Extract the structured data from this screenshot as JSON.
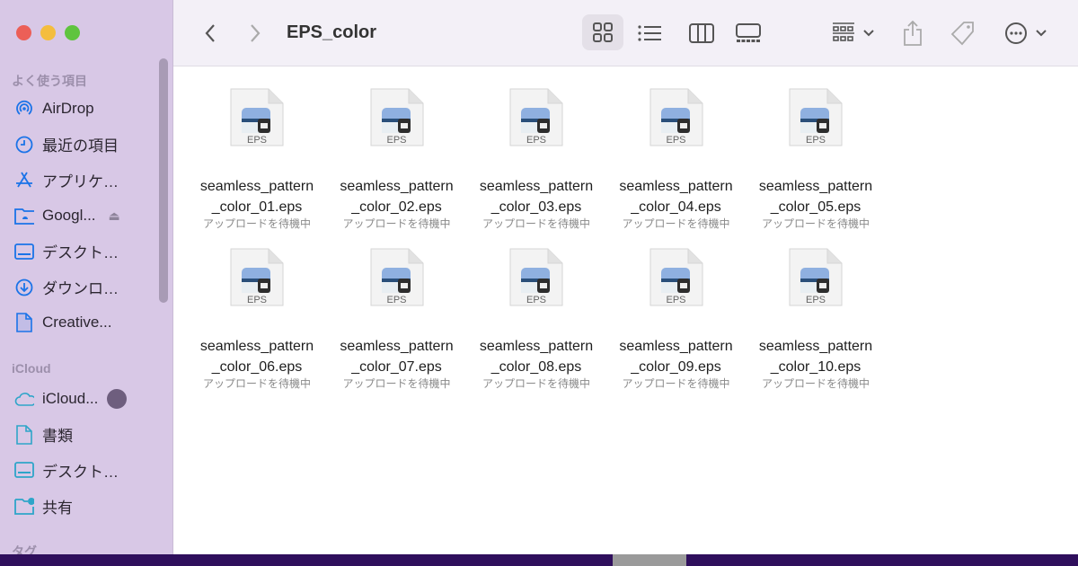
{
  "window": {
    "title": "EPS_color"
  },
  "sidebar": {
    "favorites_header": "よく使う項目",
    "favorites": [
      {
        "label": "AirDrop",
        "icon": "airdrop-icon"
      },
      {
        "label": "最近の項目",
        "icon": "clock-icon"
      },
      {
        "label": "アプリケ…",
        "icon": "applications-icon"
      },
      {
        "label": "Googl...",
        "icon": "folder-icon"
      },
      {
        "label": "デスクト…",
        "icon": "desktop-icon"
      },
      {
        "label": "ダウンロ…",
        "icon": "download-icon"
      },
      {
        "label": "Creative...",
        "icon": "document-icon"
      }
    ],
    "icloud_header": "iCloud",
    "icloud": [
      {
        "label": "iCloud...",
        "icon": "cloud-icon"
      },
      {
        "label": "書類",
        "icon": "document-icon"
      },
      {
        "label": "デスクト…",
        "icon": "desktop-icon"
      },
      {
        "label": "共有",
        "icon": "shared-folder-icon"
      }
    ],
    "tags_header": "タグ"
  },
  "colors": {
    "accent": "#1a73e8",
    "icloud": "#2ea5c9",
    "sidebar": "#d8c8e6"
  },
  "files": [
    {
      "line1": "seamless_pattern",
      "line2": "_color_01.eps",
      "status": "アップロードを待機中",
      "badge": "EPS"
    },
    {
      "line1": "seamless_pattern",
      "line2": "_color_02.eps",
      "status": "アップロードを待機中",
      "badge": "EPS"
    },
    {
      "line1": "seamless_pattern",
      "line2": "_color_03.eps",
      "status": "アップロードを待機中",
      "badge": "EPS"
    },
    {
      "line1": "seamless_pattern",
      "line2": "_color_04.eps",
      "status": "アップロードを待機中",
      "badge": "EPS"
    },
    {
      "line1": "seamless_pattern",
      "line2": "_color_05.eps",
      "status": "アップロードを待機中",
      "badge": "EPS"
    },
    {
      "line1": "seamless_pattern",
      "line2": "_color_06.eps",
      "status": "アップロードを待機中",
      "badge": "EPS"
    },
    {
      "line1": "seamless_pattern",
      "line2": "_color_07.eps",
      "status": "アップロードを待機中",
      "badge": "EPS"
    },
    {
      "line1": "seamless_pattern",
      "line2": "_color_08.eps",
      "status": "アップロードを待機中",
      "badge": "EPS"
    },
    {
      "line1": "seamless_pattern",
      "line2": "_color_09.eps",
      "status": "アップロードを待機中",
      "badge": "EPS"
    },
    {
      "line1": "seamless_pattern",
      "line2": "_color_10.eps",
      "status": "アップロードを待機中",
      "badge": "EPS"
    }
  ]
}
